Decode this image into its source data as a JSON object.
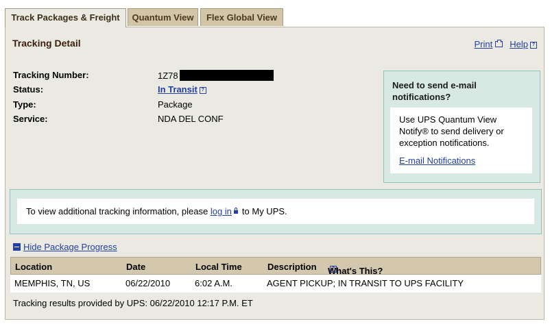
{
  "tabs": [
    {
      "label": "Track Packages & Freight",
      "active": true
    },
    {
      "label": "Quantum View",
      "active": false
    },
    {
      "label": "Flex Global View",
      "active": false
    }
  ],
  "page": {
    "title": "Tracking Detail",
    "print_label": "Print",
    "help_label": "Help"
  },
  "details": {
    "tracking_number_label": "Tracking Number:",
    "tracking_number_value": "1Z78",
    "status_label": "Status:",
    "status_value": "In Transit",
    "type_label": "Type:",
    "type_value": "Package",
    "service_label": "Service:",
    "service_value": "NDA DEL CONF"
  },
  "notify": {
    "title": "Need to send e-mail notifications?",
    "body": "Use UPS Quantum View Notify® to send delivery or exception notifications.",
    "link": "E-mail Notifications"
  },
  "login": {
    "text_before": "To view additional tracking information, please",
    "link": "log in",
    "text_after": "to My UPS."
  },
  "progress": {
    "toggle_label": "Hide Package Progress",
    "columns": [
      "Location",
      "Date",
      "Local Time",
      "Description",
      "What's This?"
    ],
    "rows": [
      {
        "location": "MEMPHIS, TN, US",
        "date": "06/22/2010",
        "time": "6:02 A.M.",
        "description": "AGENT PICKUP; IN TRANSIT TO UPS FACILITY"
      }
    ],
    "footer": "Tracking results provided by UPS:  06/22/2010 12:17 P.M.  ET"
  },
  "colors": {
    "link": "#2340a0",
    "panel_bg": "#eae9e2",
    "tab_bg": "#d2c5a8",
    "notify_bg": "#d8e8e2"
  }
}
